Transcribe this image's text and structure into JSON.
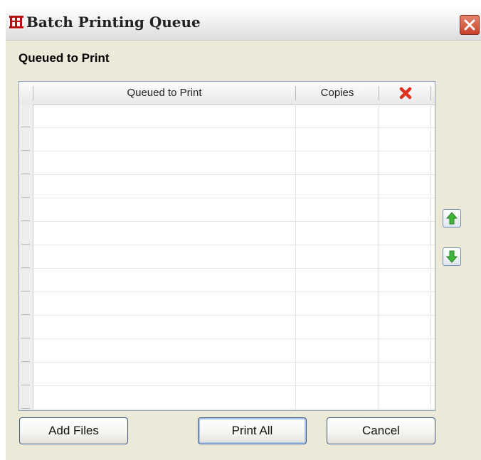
{
  "window": {
    "title": "Batch Printing Queue",
    "icon": "app-logo-icon",
    "close_icon": "close-icon"
  },
  "section": {
    "label": "Queued to Print"
  },
  "grid": {
    "columns": [
      "Queued to Print",
      "Copies"
    ],
    "delete_column_icon": "delete-x-icon",
    "rows": [
      {
        "name": "",
        "copies": ""
      },
      {
        "name": "",
        "copies": ""
      },
      {
        "name": "",
        "copies": ""
      },
      {
        "name": "",
        "copies": ""
      },
      {
        "name": "",
        "copies": ""
      },
      {
        "name": "",
        "copies": ""
      },
      {
        "name": "",
        "copies": ""
      },
      {
        "name": "",
        "copies": ""
      },
      {
        "name": "",
        "copies": ""
      },
      {
        "name": "",
        "copies": ""
      },
      {
        "name": "",
        "copies": ""
      },
      {
        "name": "",
        "copies": ""
      },
      {
        "name": "",
        "copies": ""
      }
    ]
  },
  "side_buttons": {
    "up_icon": "arrow-up-icon",
    "down_icon": "arrow-down-icon"
  },
  "buttons": {
    "add_files": "Add Files",
    "print_all": "Print All",
    "cancel": "Cancel"
  },
  "colors": {
    "arrow_green": "#3fb53a",
    "delete_red": "#e0311f",
    "close_red": "#c8412a"
  }
}
